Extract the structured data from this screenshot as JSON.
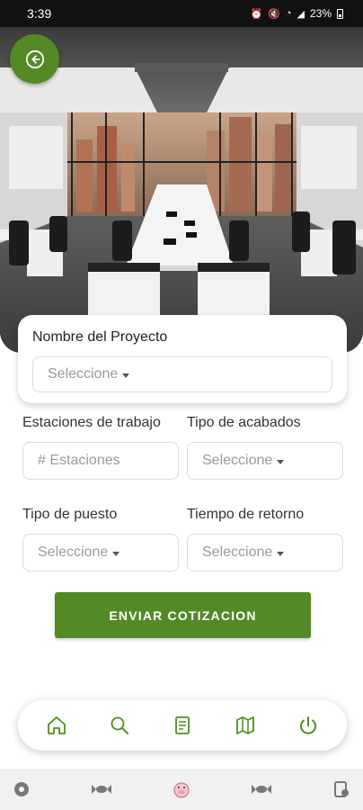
{
  "status_bar": {
    "time": "3:39",
    "battery": "23%"
  },
  "project": {
    "label": "Nombre del Proyecto",
    "placeholder": "Seleccione"
  },
  "fields": {
    "estaciones": {
      "label": "Estaciones de trabajo",
      "placeholder": "# Estaciones"
    },
    "acabados": {
      "label": "Tipo de acabados",
      "placeholder": "Seleccione"
    },
    "puesto": {
      "label": "Tipo de puesto",
      "placeholder": "Seleccione"
    },
    "retorno": {
      "label": "Tiempo de retorno",
      "placeholder": "Seleccione"
    }
  },
  "submit_label": "ENVIAR COTIZACION",
  "bottom_nav": [
    "home-icon",
    "search-icon",
    "document-icon",
    "map-icon",
    "power-icon"
  ],
  "colors": {
    "accent": "#538a26",
    "nav_icon": "#4a8f1e"
  }
}
